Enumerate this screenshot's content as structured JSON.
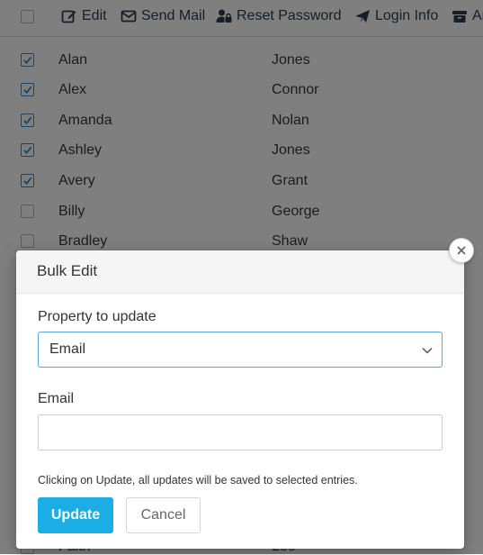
{
  "toolbar": {
    "edit_label": "Edit",
    "send_mail_label": "Send Mail",
    "reset_password_label": "Reset Password",
    "login_info_label": "Login Info",
    "archive_label": "Ar"
  },
  "rows": [
    {
      "first": "Alan",
      "last": "Jones",
      "checked": true
    },
    {
      "first": "Alex",
      "last": "Connor",
      "checked": true
    },
    {
      "first": "Amanda",
      "last": "Nolan",
      "checked": true
    },
    {
      "first": "Ashley",
      "last": "Jones",
      "checked": true
    },
    {
      "first": "Avery",
      "last": "Grant",
      "checked": true
    },
    {
      "first": "Billy",
      "last": "George",
      "checked": false
    },
    {
      "first": "Bradley",
      "last": "Shaw",
      "checked": false
    }
  ],
  "partial_row": {
    "first": "Faith",
    "last": "Lee"
  },
  "modal": {
    "title": "Bulk Edit",
    "property_label": "Property to update",
    "property_value": "Email",
    "email_label": "Email",
    "email_value": "",
    "hint": "Clicking on Update, all updates will be saved to selected entries.",
    "update_label": "Update",
    "cancel_label": "Cancel"
  },
  "colors": {
    "accent": "#1aaee5",
    "checkbox_checked": "#2d8fd0",
    "overlay": "rgba(0,0,0,0.5)"
  }
}
